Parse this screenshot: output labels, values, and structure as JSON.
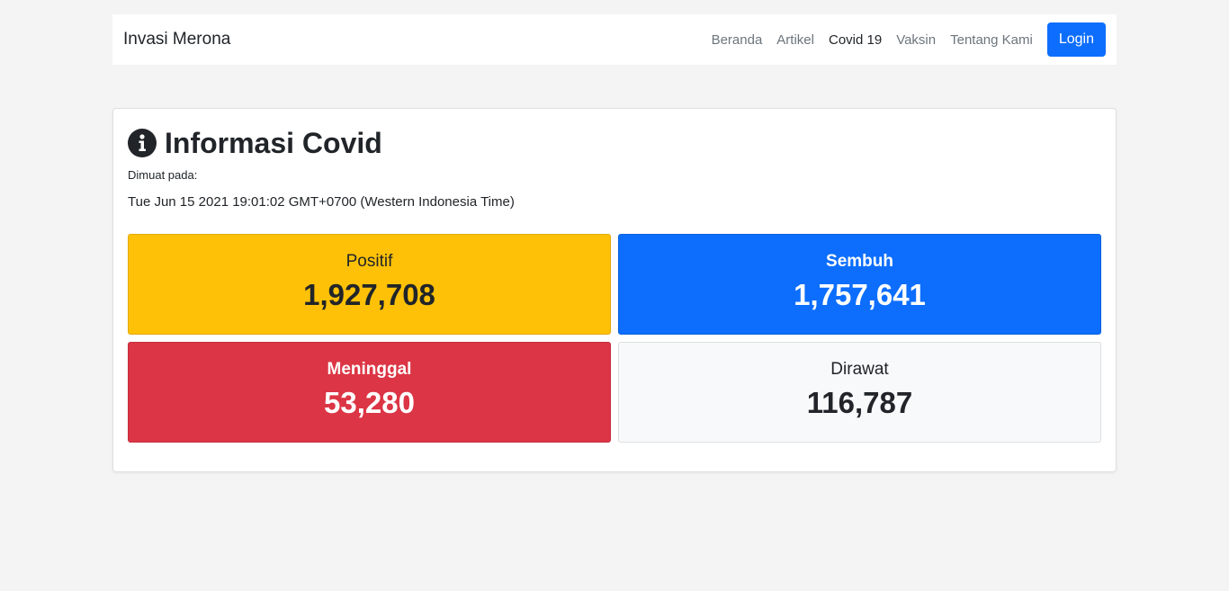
{
  "navbar": {
    "brand": "Invasi Merona",
    "links": [
      {
        "label": "Beranda",
        "active": false
      },
      {
        "label": "Artikel",
        "active": false
      },
      {
        "label": "Covid 19",
        "active": true
      },
      {
        "label": "Vaksin",
        "active": false
      },
      {
        "label": "Tentang Kami",
        "active": false
      }
    ],
    "login_label": "Login"
  },
  "card": {
    "icon": "info-circle-icon",
    "title": "Informasi Covid",
    "loaded_label": "Dimuat pada:",
    "timestamp": "Tue Jun 15 2021 19:01:02 GMT+0700 (Western Indonesia Time)"
  },
  "stats": {
    "positif": {
      "label": "Positif",
      "value": "1,927,708",
      "color": "#ffc107"
    },
    "sembuh": {
      "label": "Sembuh",
      "value": "1,757,641",
      "color": "#0d6efd"
    },
    "meninggal": {
      "label": "Meninggal",
      "value": "53,280",
      "color": "#dc3545"
    },
    "dirawat": {
      "label": "Dirawat",
      "value": "116,787",
      "color": "#f8f9fa"
    }
  },
  "colors": {
    "page_background": "#f4f4f4",
    "primary": "#0d6efd"
  }
}
